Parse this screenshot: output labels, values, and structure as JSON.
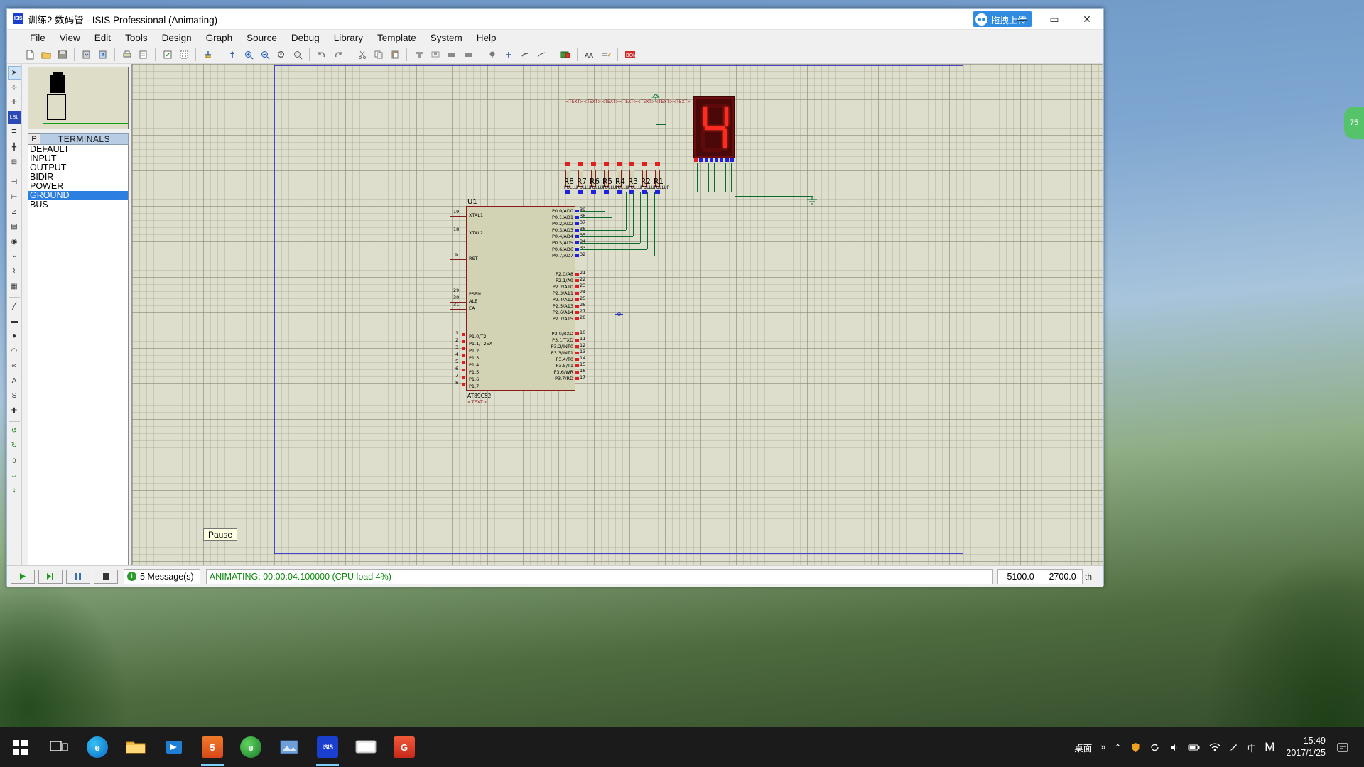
{
  "window": {
    "title": "训练2 数码管 - ISIS Professional (Animating)",
    "app_icon": "isis",
    "minimize": "—",
    "maximize": "▭",
    "close": "✕",
    "upload_button": "拖拽上传"
  },
  "menubar": {
    "items": [
      "File",
      "View",
      "Edit",
      "Tools",
      "Design",
      "Graph",
      "Source",
      "Debug",
      "Library",
      "Template",
      "System",
      "Help"
    ]
  },
  "toolbar": {
    "groups": [
      [
        "new-file-icon",
        "open-folder-icon",
        "save-icon"
      ],
      [
        "import-icon",
        "export-icon"
      ],
      [
        "print-icon",
        "print-area-icon"
      ],
      [
        "refresh-icon",
        "grid-toggle-icon"
      ],
      [
        "origin-icon"
      ],
      [
        "pan-icon",
        "zoom-in-icon",
        "zoom-out-icon",
        "zoom-area-icon",
        "zoom-all-icon"
      ],
      [
        "undo-icon",
        "redo-icon"
      ],
      [
        "cut-icon",
        "copy-icon",
        "paste-icon"
      ],
      [
        "block-copy-icon",
        "block-move-icon",
        "block-rotate-icon",
        "block-delete-icon"
      ],
      [
        "pick-device-icon",
        "make-device-icon",
        "packaging-icon",
        "decompose-icon"
      ],
      [
        "netlist-icon",
        "erc-icon",
        "netlist-compiler-icon"
      ],
      [
        "bom-icon",
        "ares-icon",
        "wire-label-icon",
        "property-icon",
        "design-explorer-icon",
        "new-sheet-icon",
        "remove-sheet-icon",
        "exit-sheet-icon"
      ],
      [
        "bill-materials-icon"
      ]
    ]
  },
  "rail": {
    "tools": [
      {
        "name": "selection-mode-icon",
        "glyph": "➤",
        "selected": true
      },
      {
        "name": "component-mode-icon",
        "glyph": "⊹"
      },
      {
        "name": "junction-dot-icon",
        "glyph": "✛"
      },
      {
        "name": "wire-label-icon",
        "glyph": "LBL"
      },
      {
        "name": "text-script-icon",
        "glyph": "≣"
      },
      {
        "name": "bus-mode-icon",
        "glyph": "╋"
      },
      {
        "name": "subcircuit-icon",
        "glyph": "⊟"
      },
      {
        "name": "terminals-mode-icon",
        "glyph": "⊣"
      },
      {
        "name": "device-pin-icon",
        "glyph": "⊢"
      },
      {
        "name": "graph-mode-icon",
        "glyph": "⊿"
      },
      {
        "name": "tape-recorder-icon",
        "glyph": "▤"
      },
      {
        "name": "generator-mode-icon",
        "glyph": "◉"
      },
      {
        "name": "voltage-probe-icon",
        "glyph": "⌁"
      },
      {
        "name": "current-probe-icon",
        "glyph": "⌇"
      },
      {
        "name": "virtual-instrument-icon",
        "glyph": "▦"
      },
      {
        "name": "2d-line-icon",
        "glyph": "╱"
      },
      {
        "name": "2d-box-icon",
        "glyph": "▬"
      },
      {
        "name": "2d-circle-icon",
        "glyph": "●"
      },
      {
        "name": "2d-arc-icon",
        "glyph": "◠"
      },
      {
        "name": "2d-path-icon",
        "glyph": "∞"
      },
      {
        "name": "2d-text-icon",
        "glyph": "A"
      },
      {
        "name": "2d-symbol-icon",
        "glyph": "S"
      },
      {
        "name": "2d-marker-icon",
        "glyph": "✚"
      },
      {
        "name": "rotate-ccw-icon",
        "glyph": "↺"
      },
      {
        "name": "rotate-cw-icon",
        "glyph": "↻"
      },
      {
        "name": "mirror-x-icon",
        "glyph": "↔"
      },
      {
        "name": "mirror-y-icon",
        "glyph": "↕"
      }
    ],
    "rotation_value": "0"
  },
  "panel": {
    "preview_label": "overview-preview",
    "p_button": "P",
    "list_title": "TERMINALS",
    "terminals": [
      {
        "label": "DEFAULT",
        "selected": false
      },
      {
        "label": "INPUT",
        "selected": false
      },
      {
        "label": "OUTPUT",
        "selected": false
      },
      {
        "label": "BIDIR",
        "selected": false
      },
      {
        "label": "POWER",
        "selected": false
      },
      {
        "label": "GROUND",
        "selected": true
      },
      {
        "label": "BUS",
        "selected": false
      }
    ],
    "tooltip": "Pause"
  },
  "schematic": {
    "u1": {
      "reference": "U1",
      "device": "AT89C52",
      "text_annotation": "<TEXT>",
      "left_pins": [
        {
          "num": "19",
          "label": "XTAL1"
        },
        {
          "num": "18",
          "label": "XTAL2"
        },
        {
          "num": "9",
          "label": "RST"
        },
        {
          "num": "29",
          "label": "PSEN"
        },
        {
          "num": "30",
          "label": "ALE"
        },
        {
          "num": "31",
          "label": "EA"
        },
        {
          "num": "1",
          "label": "P1.0/T2"
        },
        {
          "num": "2",
          "label": "P1.1/T2EX"
        },
        {
          "num": "3",
          "label": "P1.2"
        },
        {
          "num": "4",
          "label": "P1.3"
        },
        {
          "num": "5",
          "label": "P1.4"
        },
        {
          "num": "6",
          "label": "P1.5"
        },
        {
          "num": "7",
          "label": "P1.6"
        },
        {
          "num": "8",
          "label": "P1.7"
        }
      ],
      "right_pins_p0": [
        {
          "num": "39",
          "label": "P0.0/AD0"
        },
        {
          "num": "38",
          "label": "P0.1/AD1"
        },
        {
          "num": "37",
          "label": "P0.2/AD2"
        },
        {
          "num": "36",
          "label": "P0.3/AD3"
        },
        {
          "num": "35",
          "label": "P0.4/AD4"
        },
        {
          "num": "34",
          "label": "P0.5/AD5"
        },
        {
          "num": "33",
          "label": "P0.6/AD6"
        },
        {
          "num": "32",
          "label": "P0.7/AD7"
        }
      ],
      "right_pins_p2": [
        {
          "num": "21",
          "label": "P2.0/A8"
        },
        {
          "num": "22",
          "label": "P2.1/A9"
        },
        {
          "num": "23",
          "label": "P2.2/A10"
        },
        {
          "num": "24",
          "label": "P2.3/A11"
        },
        {
          "num": "25",
          "label": "P2.4/A12"
        },
        {
          "num": "26",
          "label": "P2.5/A13"
        },
        {
          "num": "27",
          "label": "P2.6/A14"
        },
        {
          "num": "28",
          "label": "P2.7/A15"
        }
      ],
      "right_pins_p3": [
        {
          "num": "10",
          "label": "P3.0/RXD"
        },
        {
          "num": "11",
          "label": "P3.1/TXD"
        },
        {
          "num": "12",
          "label": "P3.2/INT0"
        },
        {
          "num": "13",
          "label": "P3.3/INT1"
        },
        {
          "num": "14",
          "label": "P3.4/T0"
        },
        {
          "num": "15",
          "label": "P3.5/T1"
        },
        {
          "num": "16",
          "label": "P3.6/WR"
        },
        {
          "num": "17",
          "label": "P3.7/RD"
        }
      ]
    },
    "resistors": [
      {
        "ref": "R8",
        "value": "PULLUP"
      },
      {
        "ref": "R7",
        "value": "PULLUP"
      },
      {
        "ref": "R6",
        "value": "PULLUP"
      },
      {
        "ref": "R5",
        "value": "PULLUP"
      },
      {
        "ref": "R4",
        "value": "PULLUP"
      },
      {
        "ref": "R3",
        "value": "PULLUP"
      },
      {
        "ref": "R2",
        "value": "PULLUP"
      },
      {
        "ref": "R1",
        "value": "PULLUP"
      }
    ],
    "resistor_note": "<TEXT><TEXT><TEXT><TEXT><TEXT><TEXT><TEXT>",
    "display": {
      "name": "7-segment-display",
      "digit": "4",
      "segments": {
        "a": false,
        "b": true,
        "c": true,
        "d": false,
        "e": false,
        "f": true,
        "g": true
      },
      "color": "#ff2a20"
    },
    "ground_symbol": "ground-symbol",
    "power_symbol": "power-symbol"
  },
  "statusbar": {
    "play": "▶",
    "step": "▶|",
    "pause": "❚❚",
    "stop": "■",
    "messages": "5 Message(s)",
    "message_icon": "i",
    "animating": "ANIMATING: 00:00:04.100000 (CPU load 4%)",
    "coord_x": "-5100.0",
    "coord_y": "-2700.0",
    "units": "th"
  },
  "taskbar": {
    "start": "start-button",
    "items": [
      {
        "name": "task-view-icon",
        "glyph": "❐",
        "color": "#2b2b2b",
        "active": false
      },
      {
        "name": "edge-browser-icon",
        "glyph": "e",
        "color": "#0a68c4",
        "active": false
      },
      {
        "name": "file-explorer-icon",
        "glyph": "📁",
        "color": "#e8a317",
        "active": false
      },
      {
        "name": "store-icon",
        "glyph": "⊞",
        "color": "#1e7fd4",
        "active": false
      },
      {
        "name": "proteus-ares-icon",
        "glyph": "5",
        "color": "#e85a1a",
        "active": true
      },
      {
        "name": "firefox-icon",
        "glyph": "e",
        "color": "#3aa33a",
        "active": false
      },
      {
        "name": "photos-icon",
        "glyph": "▧",
        "color": "#4a7ec4",
        "active": false
      },
      {
        "name": "isis-icon",
        "glyph": "ISIS",
        "color": "#1a3fcf",
        "active": true
      },
      {
        "name": "media-player-icon",
        "glyph": "▭",
        "color": "#dddddd",
        "active": false
      },
      {
        "name": "app-g-icon",
        "glyph": "G",
        "color": "#e03c2a",
        "active": false
      }
    ],
    "tray": {
      "desktop_label": "桌面",
      "overflow": "»",
      "icons": [
        "chevron-up-icon",
        "shield-icon",
        "sync-icon",
        "volume-icon",
        "battery-icon",
        "wifi-icon",
        "ime-pen-icon",
        "ime-chinese-icon",
        "ime-mode-icon"
      ],
      "ime_chinese": "中",
      "ime_m": "M",
      "time": "15:49",
      "date": "2017/1/25",
      "action_center": "notification-icon"
    }
  },
  "right_widget": {
    "label": "75"
  }
}
